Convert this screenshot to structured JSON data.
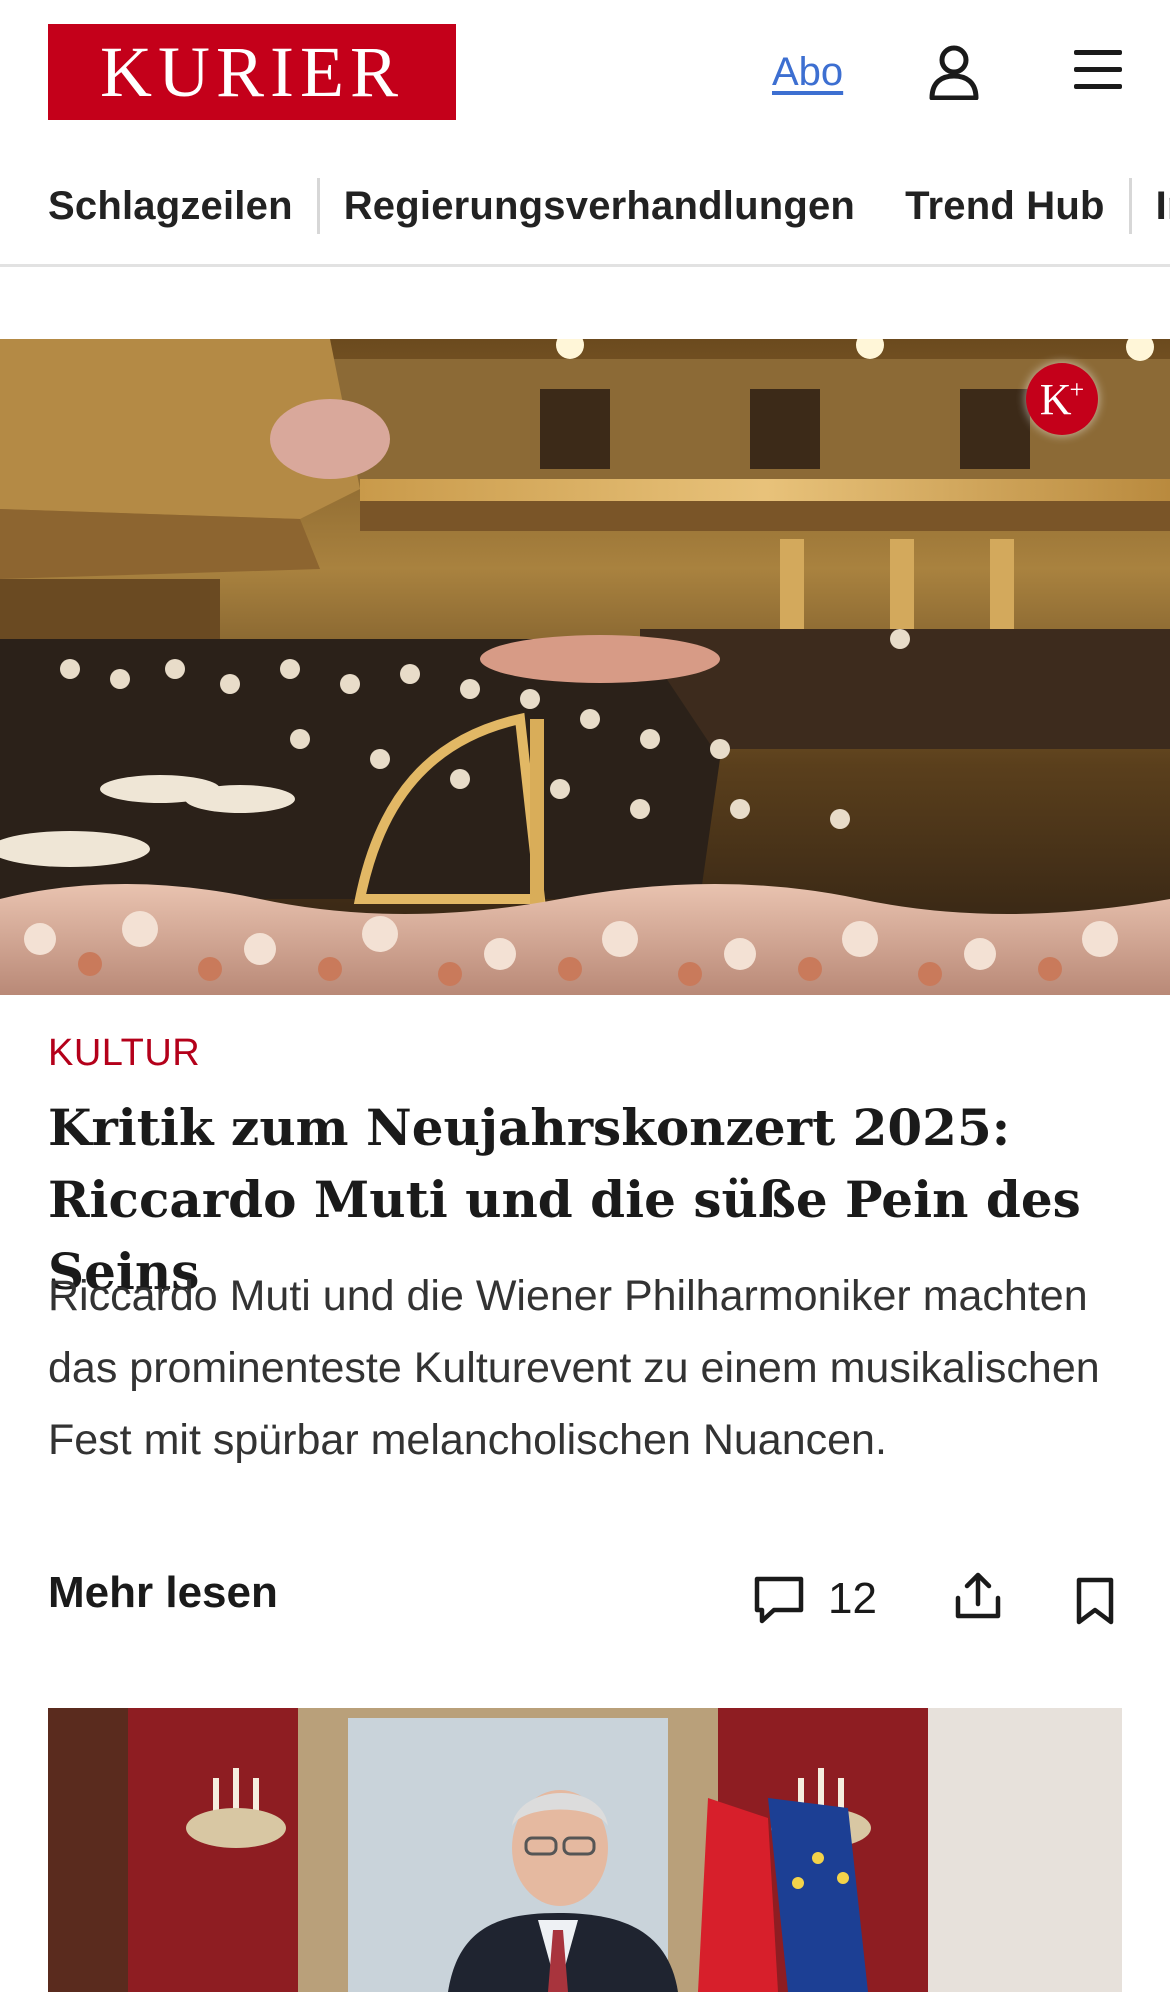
{
  "header": {
    "logo_text": "KURIER",
    "abo_label": "Abo",
    "user_icon": "user-icon",
    "menu_icon": "hamburger-menu-icon",
    "brand_color": "#c4001a"
  },
  "nav": {
    "items": [
      {
        "label": "Schlagzeilen"
      },
      {
        "label": "Regierungsverhandlungen"
      },
      {
        "label": "Trend Hub"
      },
      {
        "label": "In"
      }
    ]
  },
  "article": {
    "premium_badge": "K",
    "premium_badge_sup": "+",
    "kicker": "KULTUR",
    "headline": "Kritik zum Neujahrskonzert 2025: Riccardo Muti und die süße Pein des Seins",
    "teaser": "Riccardo Muti und die Wiener Philharmoniker machten das prominenteste Kulturevent zu einem musikalischen Fest mit spürbar melancholischen Nuancen.",
    "more_label": "Mehr lesen",
    "comment_count": "12",
    "comment_icon": "comment-icon",
    "share_icon": "share-icon",
    "bookmark_icon": "bookmark-icon",
    "kicker_color": "#b4001a"
  }
}
